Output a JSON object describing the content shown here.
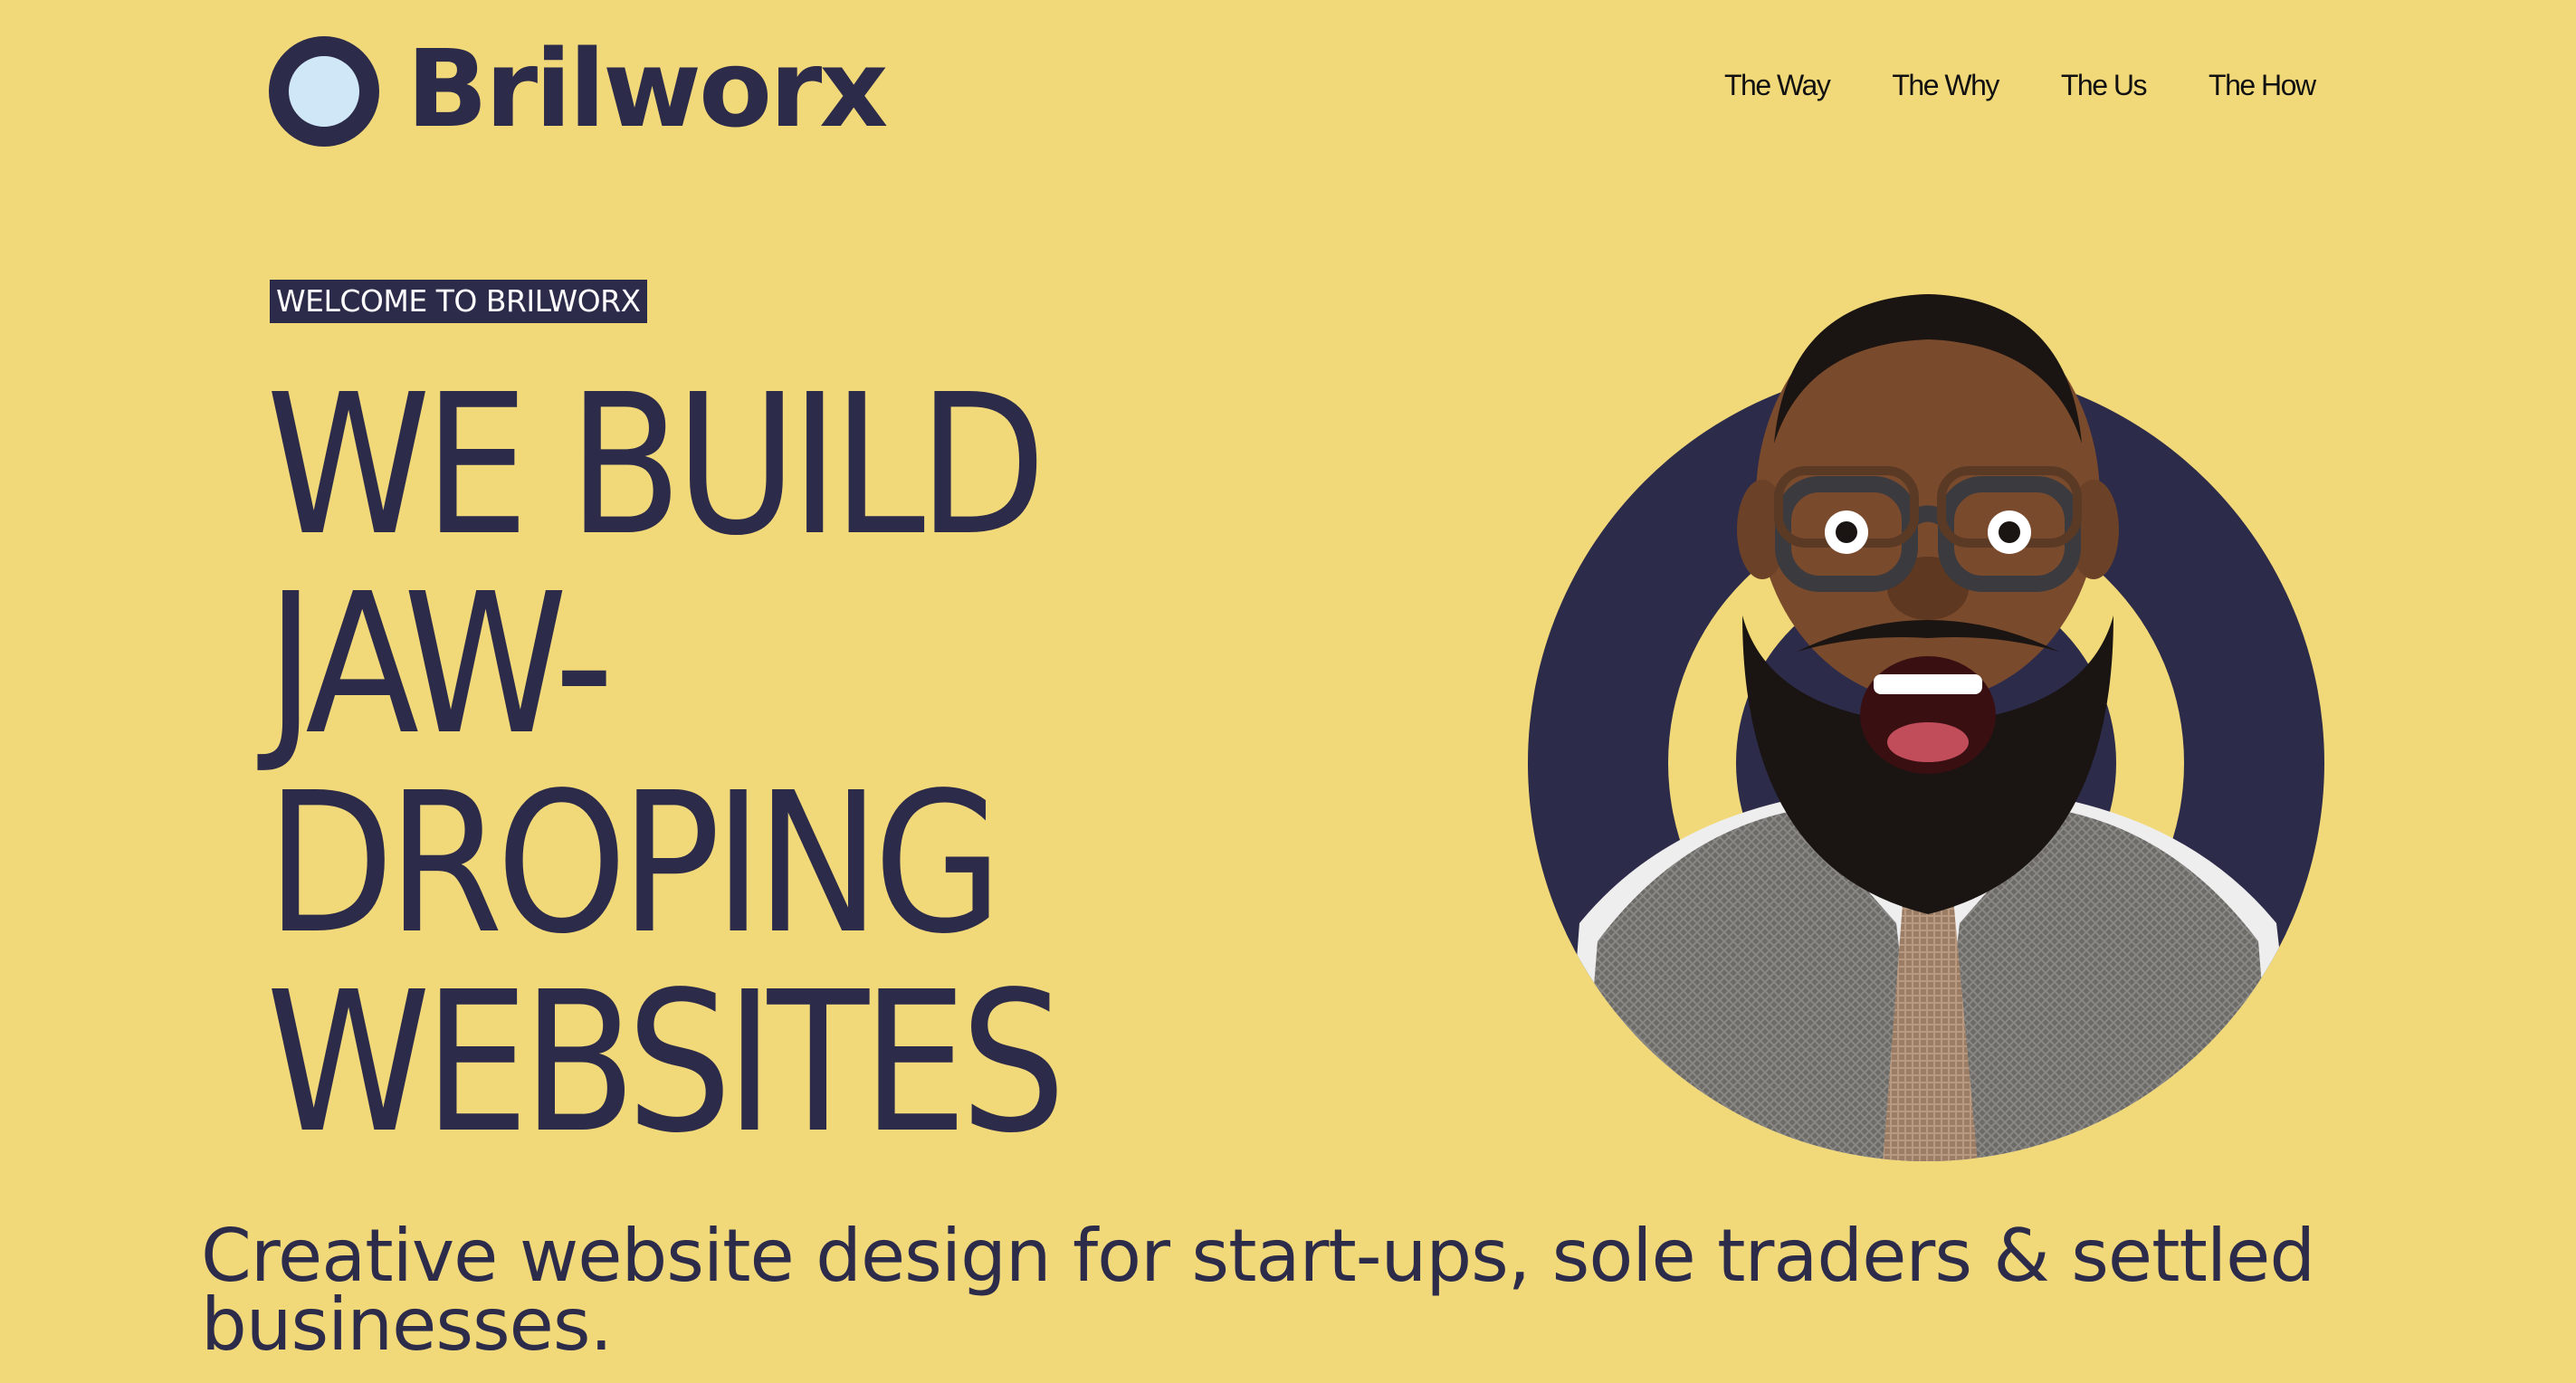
{
  "brand": {
    "name": "Brilworx",
    "colors": {
      "background": "#f1d97a",
      "primary": "#2d2b4a",
      "logo_center": "#cfe7f7",
      "nav_text": "#111111"
    }
  },
  "nav": {
    "items": [
      {
        "label": "The Way"
      },
      {
        "label": "The Why"
      },
      {
        "label": "The Us"
      },
      {
        "label": "The How"
      }
    ]
  },
  "hero": {
    "eyebrow": "WELCOME TO BRILWORX",
    "headline_lines": [
      "WE BUILD",
      "JAW-",
      "DROPING",
      "WEBSITES"
    ],
    "subheadline_lines": [
      "Creative website design for start-ups, sole traders & settled",
      "businesses."
    ],
    "image": {
      "icon": "excited-bearded-man-portrait",
      "ring_color": "#2d2b4a"
    }
  }
}
